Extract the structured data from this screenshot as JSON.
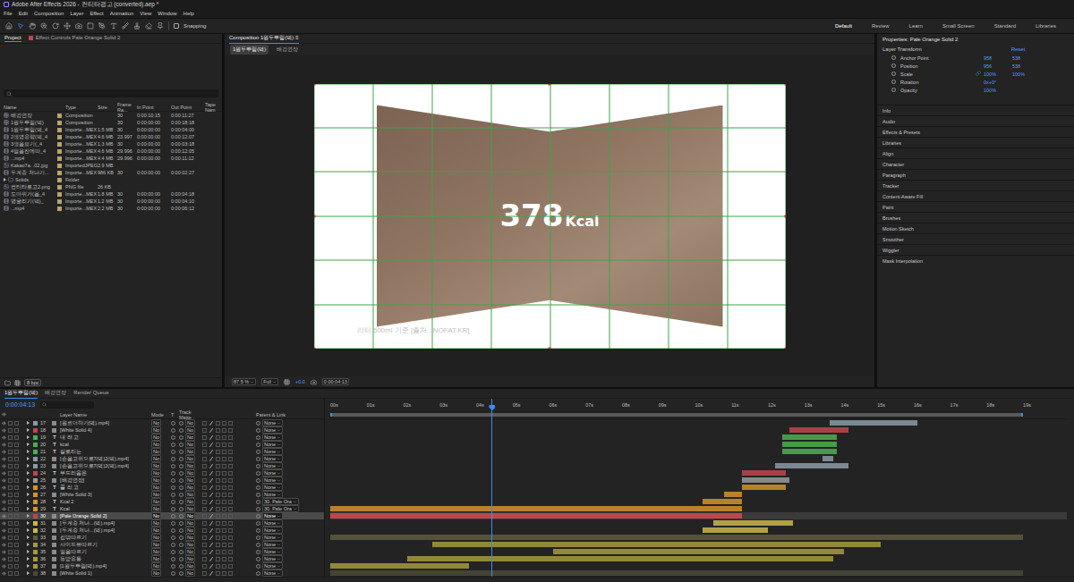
{
  "window": {
    "title": "Adobe After Effects 2026 - 컨티타광고 (converted).aep *"
  },
  "menu": [
    "File",
    "Edit",
    "Composition",
    "Layer",
    "Effect",
    "Animation",
    "View",
    "Window",
    "Help"
  ],
  "toolbar": {
    "snapping": {
      "label": "Snapping",
      "checked": false
    },
    "workspaces": [
      {
        "label": "Default",
        "selected": true
      },
      {
        "label": "Review",
        "selected": false
      },
      {
        "label": "Learn",
        "selected": false
      },
      {
        "label": "Small Screen",
        "selected": false
      },
      {
        "label": "Standard",
        "selected": false
      },
      {
        "label": "Libraries",
        "selected": false
      }
    ]
  },
  "project": {
    "tabs": [
      {
        "label": "Project",
        "selected": true
      },
      {
        "label": "Effect Controls Pale Orange Solid 2",
        "selected": false
      }
    ],
    "columns": [
      "Name",
      "Type",
      "Size",
      "Frame Ra...",
      "In Point",
      "Out Point",
      "Tape Nam"
    ],
    "rows": [
      {
        "name": "배경연장",
        "kind": "composition",
        "type": "Composition",
        "size": "",
        "fps": "30",
        "in": "0:00:10:15",
        "out": "0:00:11:27"
      },
      {
        "name": "1원두뿌림(덕)",
        "kind": "composition",
        "type": "Composition",
        "size": "",
        "fps": "30",
        "in": "0:00:00:00",
        "out": "0:00:18:18"
      },
      {
        "name": "1원두뿌림(덕_4",
        "kind": "footage",
        "type": "Importe...MEX",
        "size": "1.5 MB",
        "fps": "30",
        "in": "0:00:00:00",
        "out": "0:00:04:00"
      },
      {
        "name": "2생명용량(덕_4",
        "kind": "footage",
        "type": "Importe...MEX",
        "size": "4.6 MB",
        "fps": "23.997",
        "in": "0:00:00:00",
        "out": "0:00:12:07"
      },
      {
        "name": "3생음보기(_4",
        "kind": "footage",
        "type": "Importe...MEX",
        "size": "1.3 MB",
        "fps": "30",
        "in": "0:00:00:00",
        "out": "0:00:03:18"
      },
      {
        "name": "4얼음잔에따_4",
        "kind": "footage",
        "type": "Importe...MEX",
        "size": "4.6 MB",
        "fps": "29.996",
        "in": "0:00:00:00",
        "out": "0:00:12:05"
      },
      {
        "name": "...mp4",
        "kind": "footage",
        "type": "Importe...MEX",
        "size": "4.4 MB",
        "fps": "29.996",
        "in": "0:00:00:00",
        "out": "0:00:11:12"
      },
      {
        "name": "Kakao7a...02.jpg",
        "kind": "image",
        "type": "ImportedJPEG",
        "size": "2.9 MB",
        "fps": "",
        "in": "",
        "out": ""
      },
      {
        "name": "두계중 쳐나기...",
        "kind": "footage",
        "type": "Importe...MEX",
        "size": "986 KB",
        "fps": "30",
        "in": "0:00:00:00",
        "out": "0:00:02:27"
      },
      {
        "name": "Solids",
        "kind": "folder",
        "type": "Folder",
        "size": "",
        "fps": "",
        "in": "",
        "out": "",
        "expanded": false
      },
      {
        "name": "컨티타로고2.png",
        "kind": "image",
        "type": "PNG file",
        "size": "26 KB",
        "fps": "",
        "in": "",
        "out": ""
      },
      {
        "name": "도마위가(음_4",
        "kind": "footage",
        "type": "Importe...MEX",
        "size": "1.8 MB",
        "fps": "30",
        "in": "0:00:00:00",
        "out": "0:00:04:18"
      },
      {
        "name": "병굴리기(덕)_",
        "kind": "footage",
        "type": "Importe...MEX",
        "size": "1.2 MB",
        "fps": "30",
        "in": "0:00:00:00",
        "out": "0:00:04:10"
      },
      {
        "name": "...mp4",
        "kind": "footage",
        "type": "Importe...MEX",
        "size": "2.2 MB",
        "fps": "30",
        "in": "0:00:00:00",
        "out": "0:00:06:12"
      }
    ],
    "bit_depth": "8 bpc"
  },
  "composition": {
    "tab": "Composition 1원두뿌림(덕)",
    "menu_glyph": "≡",
    "views": [
      {
        "label": "1원두뿌림(덕)",
        "selected": true
      },
      {
        "label": "배경연장",
        "selected": false
      }
    ],
    "headline": "378",
    "unit": "Kcal",
    "caption": "리터 500ml 기준 [출처 : NOFAT.KR]",
    "zoom": "87.5 %",
    "resolution": "Full",
    "exposure": "+0.0",
    "time": "0:00:04:13"
  },
  "properties": {
    "title": "Properties: Pale Orange Solid 2",
    "section": "Layer Transform",
    "reset": "Reset",
    "rows": [
      {
        "label": "Anchor Point",
        "values": [
          "958",
          "538"
        ],
        "keyframed": false,
        "linked": false
      },
      {
        "label": "Position",
        "values": [
          "956",
          "538"
        ],
        "keyframed": true,
        "linked": false
      },
      {
        "label": "Scale",
        "values": [
          "100%",
          "100%"
        ],
        "keyframed": false,
        "linked": true
      },
      {
        "label": "Rotation",
        "values": [
          "0x+0°"
        ],
        "keyframed": false,
        "linked": false
      },
      {
        "label": "Opacity",
        "values": [
          "100%"
        ],
        "keyframed": false,
        "linked": false
      }
    ]
  },
  "panels": [
    "Info",
    "Audio",
    "Effects & Presets",
    "Libraries",
    "Align",
    "Character",
    "Paragraph",
    "Tracker",
    "Content-Aware Fill",
    "Paint",
    "Brushes",
    "Motion Sketch",
    "Smoother",
    "Wiggler",
    "Mask Interpolation"
  ],
  "timeline": {
    "tabs": [
      {
        "label": "1원두뿌림(덕)",
        "selected": true
      },
      {
        "label": "배경연장",
        "selected": false
      },
      {
        "label": "Render Queue",
        "selected": false
      }
    ],
    "time": "0:00:04:13",
    "playhead": 4.43,
    "work_area": {
      "start": 0,
      "end": 19
    },
    "columns": [
      "Layer Name",
      "Mode",
      "T",
      "Track Matte",
      "Parent & Link"
    ],
    "ticks": [
      "00s",
      "01s",
      "02s",
      "03s",
      "04s",
      "05s",
      "06s",
      "07s",
      "08s",
      "09s",
      "10s",
      "11s",
      "12s",
      "13s",
      "14s",
      "15s",
      "16s",
      "17s",
      "18s",
      "19s"
    ],
    "layers": [
      {
        "num": "17",
        "name": "[원료더하기(덕).mp4]",
        "kind": "footage",
        "mode": "No",
        "matte": "No",
        "parent": "None",
        "color": "#8a9aa6",
        "start": 13.7,
        "end": 16.1,
        "visible": true,
        "selected": false
      },
      {
        "num": "18",
        "name": "[White Solid 4]",
        "kind": "solid",
        "mode": "No",
        "matte": "No",
        "parent": "None",
        "color": "#c0464c",
        "start": 12.6,
        "end": 14.2,
        "visible": true,
        "selected": false
      },
      {
        "num": "19",
        "name": "내 려 고",
        "kind": "text",
        "icon": "T",
        "mode": "No",
        "matte": "No",
        "parent": "None",
        "color": "#4caf50",
        "start": 12.4,
        "end": 13.9,
        "visible": true,
        "selected": false
      },
      {
        "num": "20",
        "name": "kcal",
        "kind": "text",
        "icon": "T",
        "mode": "No",
        "matte": "No",
        "parent": "None",
        "color": "#4caf50",
        "start": 12.4,
        "end": 13.9,
        "visible": true,
        "selected": false
      },
      {
        "num": "21",
        "name": "칼로리는",
        "kind": "text",
        "icon": "T",
        "mode": "No",
        "matte": "No",
        "parent": "None",
        "color": "#4caf50",
        "start": 12.4,
        "end": 13.9,
        "visible": true,
        "selected": false
      },
      {
        "num": "22",
        "name": "[손음고위으로7(덕)2(덕).mp4]",
        "kind": "footage",
        "mode": "No",
        "matte": "No",
        "parent": "None",
        "color": "#8a9aa6",
        "start": 13.5,
        "end": 13.8,
        "visible": true,
        "selected": false
      },
      {
        "num": "23",
        "name": "[손음고위으로7(덕)2(덕).mp4]",
        "kind": "footage",
        "mode": "No",
        "matte": "No",
        "parent": "None",
        "color": "#8a9aa6",
        "start": 12.2,
        "end": 14.2,
        "visible": true,
        "selected": false
      },
      {
        "num": "24",
        "name": "부드러움은",
        "kind": "text",
        "icon": "T",
        "mode": "No",
        "matte": "No",
        "parent": "None",
        "color": "#c0464c",
        "start": 11.3,
        "end": 12.5,
        "visible": true,
        "selected": false
      },
      {
        "num": "25",
        "name": "[배경연장]",
        "kind": "composition",
        "mode": "No",
        "matte": "No",
        "parent": "None",
        "color": "#9a9a9a",
        "start": 11.3,
        "end": 12.6,
        "visible": true,
        "selected": false
      },
      {
        "num": "26",
        "name": "풀 리 고",
        "kind": "text",
        "icon": "T",
        "mode": "No",
        "matte": "No",
        "parent": "None",
        "color": "#d4932b",
        "start": 11.3,
        "end": 12.5,
        "visible": true,
        "selected": false
      },
      {
        "num": "27",
        "name": "[White Solid 3]",
        "kind": "solid",
        "mode": "No",
        "matte": "No",
        "parent": "None",
        "color": "#d4932b",
        "start": 10.8,
        "end": 11.3,
        "visible": true,
        "selected": false
      },
      {
        "num": "28",
        "name": "Kcal 2",
        "kind": "text",
        "icon": "T",
        "mode": "No",
        "matte": "No",
        "parent": "30. Pale Ora",
        "color": "#d4932b",
        "start": 10.2,
        "end": 11.3,
        "visible": true,
        "selected": false
      },
      {
        "num": "29",
        "name": "Kcal",
        "kind": "text",
        "icon": "T",
        "mode": "No",
        "matte": "No",
        "parent": "30. Pale Ora",
        "color": "#d4932b",
        "start": 0,
        "end": 11.3,
        "visible": true,
        "selected": false
      },
      {
        "num": "30",
        "name": "[Pale Orange Solid 2]",
        "kind": "solid",
        "mode": "No",
        "matte": "No",
        "parent": "None",
        "color": "#c0464c",
        "start": 0,
        "end": 11.3,
        "visible": true,
        "selected": true
      },
      {
        "num": "31",
        "name": "[두계중 쳐나...(덕).mp4]",
        "kind": "footage",
        "mode": "No",
        "matte": "No",
        "parent": "None",
        "color": "#c9b84a",
        "start": 10.5,
        "end": 12.7,
        "visible": true,
        "selected": false
      },
      {
        "num": "32",
        "name": "[두계중 쳐나...(덕).mp4]",
        "kind": "footage",
        "mode": "No",
        "matte": "No",
        "parent": "None",
        "color": "#c9b84a",
        "start": 10.2,
        "end": 12.0,
        "visible": true,
        "selected": false
      },
      {
        "num": "33",
        "name": "컵밖따르기",
        "kind": "composition",
        "mode": "No",
        "matte": "No",
        "parent": "None",
        "color": "#5d5c3a",
        "start": 0,
        "end": 19,
        "visible": true,
        "selected": false
      },
      {
        "num": "34",
        "name": "사이드뷰따르기",
        "kind": "composition",
        "mode": "No",
        "matte": "No",
        "parent": "None",
        "color": "#a69a3c",
        "start": 2.8,
        "end": 15.1,
        "visible": true,
        "selected": false
      },
      {
        "num": "35",
        "name": "얼음따르기",
        "kind": "composition",
        "mode": "No",
        "matte": "No",
        "parent": "None",
        "color": "#a69a3c",
        "start": 6.1,
        "end": 14.1,
        "visible": true,
        "selected": false
      },
      {
        "num": "36",
        "name": "동받용통",
        "kind": "composition",
        "mode": "No",
        "matte": "No",
        "parent": "None",
        "color": "#a69a3c",
        "start": 2.1,
        "end": 13.8,
        "visible": true,
        "selected": false
      },
      {
        "num": "37",
        "name": "[1원두뿌림(덕).mp4]",
        "kind": "footage",
        "mode": "No",
        "matte": "No",
        "parent": "None",
        "color": "#a69a3c",
        "start": 0,
        "end": 3.8,
        "visible": true,
        "selected": false
      },
      {
        "num": "38",
        "name": "[White Solid 1]",
        "kind": "solid",
        "mode": "No",
        "matte": "No",
        "parent": "None",
        "color": "#4a4a3a",
        "start": 0,
        "end": 19,
        "visible": true,
        "selected": false
      }
    ]
  }
}
